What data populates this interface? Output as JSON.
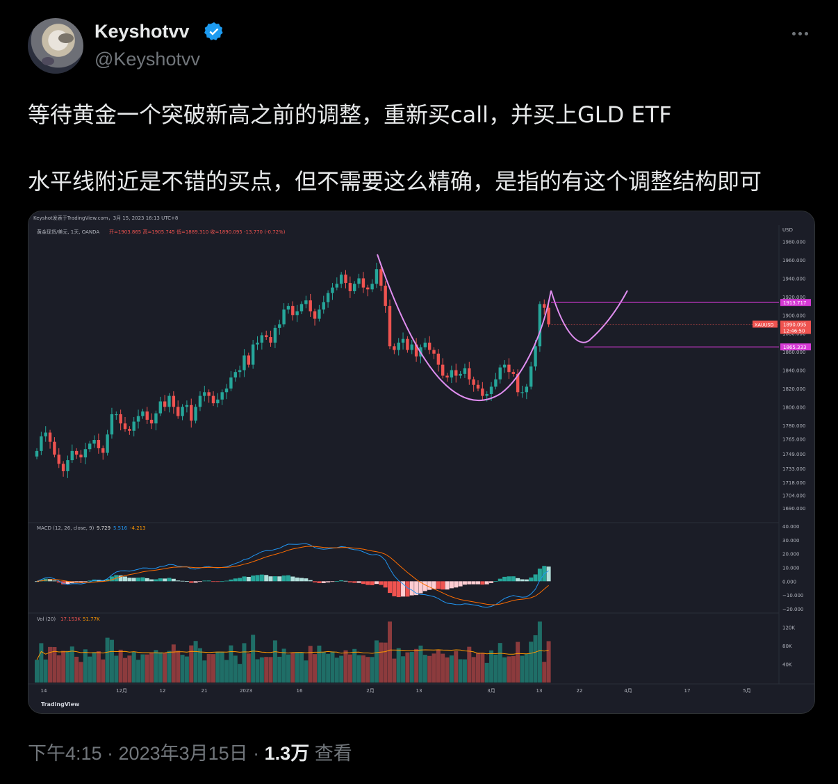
{
  "tweet": {
    "display_name": "Keyshotvv",
    "handle": "@Keyshotvv",
    "line1": "等待黄金一个突破新高之前的调整，重新买call，并买上GLD ETF",
    "line2": "水平线附近是不错的买点，但不需要这么精确，是指的有这个调整结构即可",
    "timestamp": "下午4:15 · 2023年3月15日 · ",
    "views_count": "1.3万",
    "views_label": " 查看"
  },
  "chart": {
    "header": "Keyshot发表于TradingView.com，3月 15, 2023 16:13 UTC+8",
    "symbol_line": "黄金现货/美元, 1天, OANDA",
    "ohlc": "开=1903.865  高=1905.745  低=1889.310  收=1890.095  -13.770 (-0.72%)",
    "currency": "USD",
    "macd_label": "MACD (12, 26, close, 9)",
    "macd_values": [
      "9.729",
      "5.516",
      "-4.213"
    ],
    "vol_label": "Vol (20)",
    "vol_values": [
      "17.153K",
      "51.77K"
    ],
    "brand": "TradingView",
    "price_ticks": [
      "1980.000",
      "1960.000",
      "1940.000",
      "1920.000",
      "1900.000",
      "1880.000",
      "1860.000",
      "1840.000",
      "1820.000",
      "1800.000",
      "1780.000",
      "1765.000",
      "1749.000",
      "1733.000",
      "1718.000",
      "1704.000",
      "1690.000"
    ],
    "tag_upper": "1913.717",
    "tag_symbol": "XAUUSD",
    "tag_price": "1890.095",
    "tag_time": "12:46:50",
    "tag_lower": "1865.333",
    "macd_ticks": [
      "40.000",
      "30.000",
      "20.000",
      "10.000",
      "0.000",
      "−10.000",
      "−20.000"
    ],
    "vol_ticks": [
      "120K",
      "80K",
      "40K"
    ],
    "time_labels": [
      "14",
      "12月",
      "12",
      "21",
      "2023",
      "16",
      "2月",
      "13",
      "3月",
      "13",
      "22",
      "4月",
      "17",
      "5月"
    ],
    "colors": {
      "up": "#26a69a",
      "down": "#ef5350",
      "curve": "#e08ef0",
      "level": "#d63ad6",
      "bg": "#1b1d27"
    }
  },
  "chart_data": {
    "type": "candlestick",
    "title": "黄金现货/美元, 1天, OANDA",
    "ylabel": "USD",
    "ylim": [
      1680,
      1985
    ],
    "horizontal_lines": [
      1913.717,
      1865.333
    ],
    "last_price": 1890.095,
    "macd": {
      "macd": 9.729,
      "signal": 5.516,
      "histogram": -4.213
    },
    "volume": {
      "last": "17.153K",
      "ma": "51.77K"
    },
    "closes": [
      1752,
      1768,
      1772,
      1762,
      1748,
      1738,
      1730,
      1742,
      1752,
      1748,
      1745,
      1754,
      1760,
      1764,
      1755,
      1750,
      1770,
      1792,
      1792,
      1782,
      1776,
      1774,
      1784,
      1790,
      1795,
      1786,
      1782,
      1793,
      1806,
      1800,
      1812,
      1800,
      1790,
      1800,
      1802,
      1785,
      1800,
      1812,
      1816,
      1812,
      1804,
      1808,
      1816,
      1820,
      1832,
      1838,
      1840,
      1856,
      1846,
      1868,
      1870,
      1878,
      1876,
      1870,
      1886,
      1890,
      1906,
      1910,
      1900,
      1904,
      1912,
      1916,
      1904,
      1896,
      1906,
      1914,
      1924,
      1930,
      1934,
      1944,
      1935,
      1926,
      1934,
      1940,
      1930,
      1928,
      1934,
      1950,
      1932,
      1910,
      1866,
      1862,
      1870,
      1874,
      1862,
      1868,
      1855,
      1865,
      1870,
      1862,
      1858,
      1846,
      1834,
      1832,
      1840,
      1834,
      1836,
      1842,
      1830,
      1824,
      1820,
      1812,
      1814,
      1822,
      1830,
      1843,
      1846,
      1838,
      1836,
      1816,
      1816,
      1822,
      1844,
      1866,
      1912,
      1908,
      1890
    ]
  }
}
